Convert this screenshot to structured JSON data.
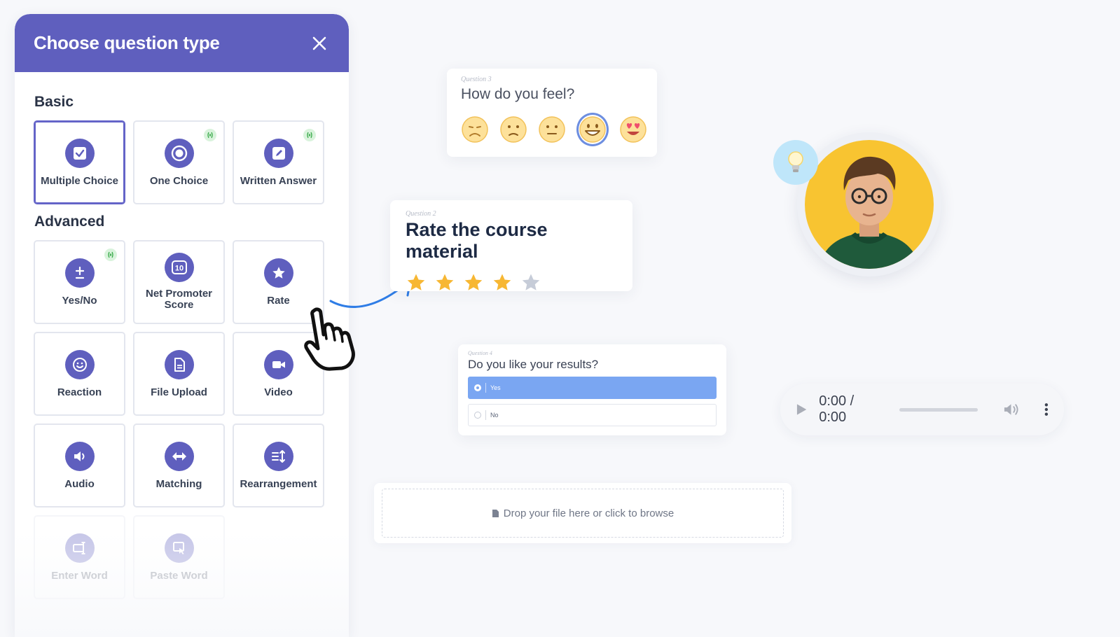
{
  "dialog": {
    "title": "Choose question type",
    "sections": {
      "basic": "Basic",
      "advanced": "Advanced"
    },
    "basic_items": [
      {
        "label": "Multiple Choice",
        "icon": "checkbox-icon",
        "selected": true
      },
      {
        "label": "One Choice",
        "icon": "radio-icon",
        "badge": true
      },
      {
        "label": "Written Answer",
        "icon": "pencil-icon",
        "badge": true
      }
    ],
    "advanced_items": [
      {
        "label": "Yes/No",
        "icon": "plus-minus-icon",
        "badge": true
      },
      {
        "label": "Net Promoter Score",
        "icon": "nps-10-icon"
      },
      {
        "label": "Rate",
        "icon": "star-icon"
      },
      {
        "label": "Reaction",
        "icon": "smiley-icon"
      },
      {
        "label": "File Upload",
        "icon": "file-icon"
      },
      {
        "label": "Video",
        "icon": "video-camera-icon"
      },
      {
        "label": "Audio",
        "icon": "speaker-icon"
      },
      {
        "label": "Matching",
        "icon": "double-arrow-icon"
      },
      {
        "label": "Rearrangement",
        "icon": "sort-icon"
      },
      {
        "label": "Enter Word",
        "icon": "text-cursor-icon"
      },
      {
        "label": "Paste Word",
        "icon": "paste-icon"
      }
    ]
  },
  "feel_card": {
    "qnum": "Question 3",
    "title": "How do you feel?",
    "selected_index": 3
  },
  "rate_card": {
    "qnum": "Question 2",
    "title": "Rate the course material",
    "rating": 4,
    "max": 5
  },
  "results_card": {
    "qnum": "Question 4",
    "title": "Do you like your results?",
    "options": [
      "Yes",
      "No"
    ],
    "selected": "Yes"
  },
  "dropzone": {
    "text": "Drop your file here or click to browse"
  },
  "player": {
    "time": "0:00 / 0:00"
  },
  "colors": {
    "accent": "#5f5fbe",
    "star": "#f7b733",
    "option_active": "#7aa6f2",
    "avatar_bg": "#f8c431"
  }
}
